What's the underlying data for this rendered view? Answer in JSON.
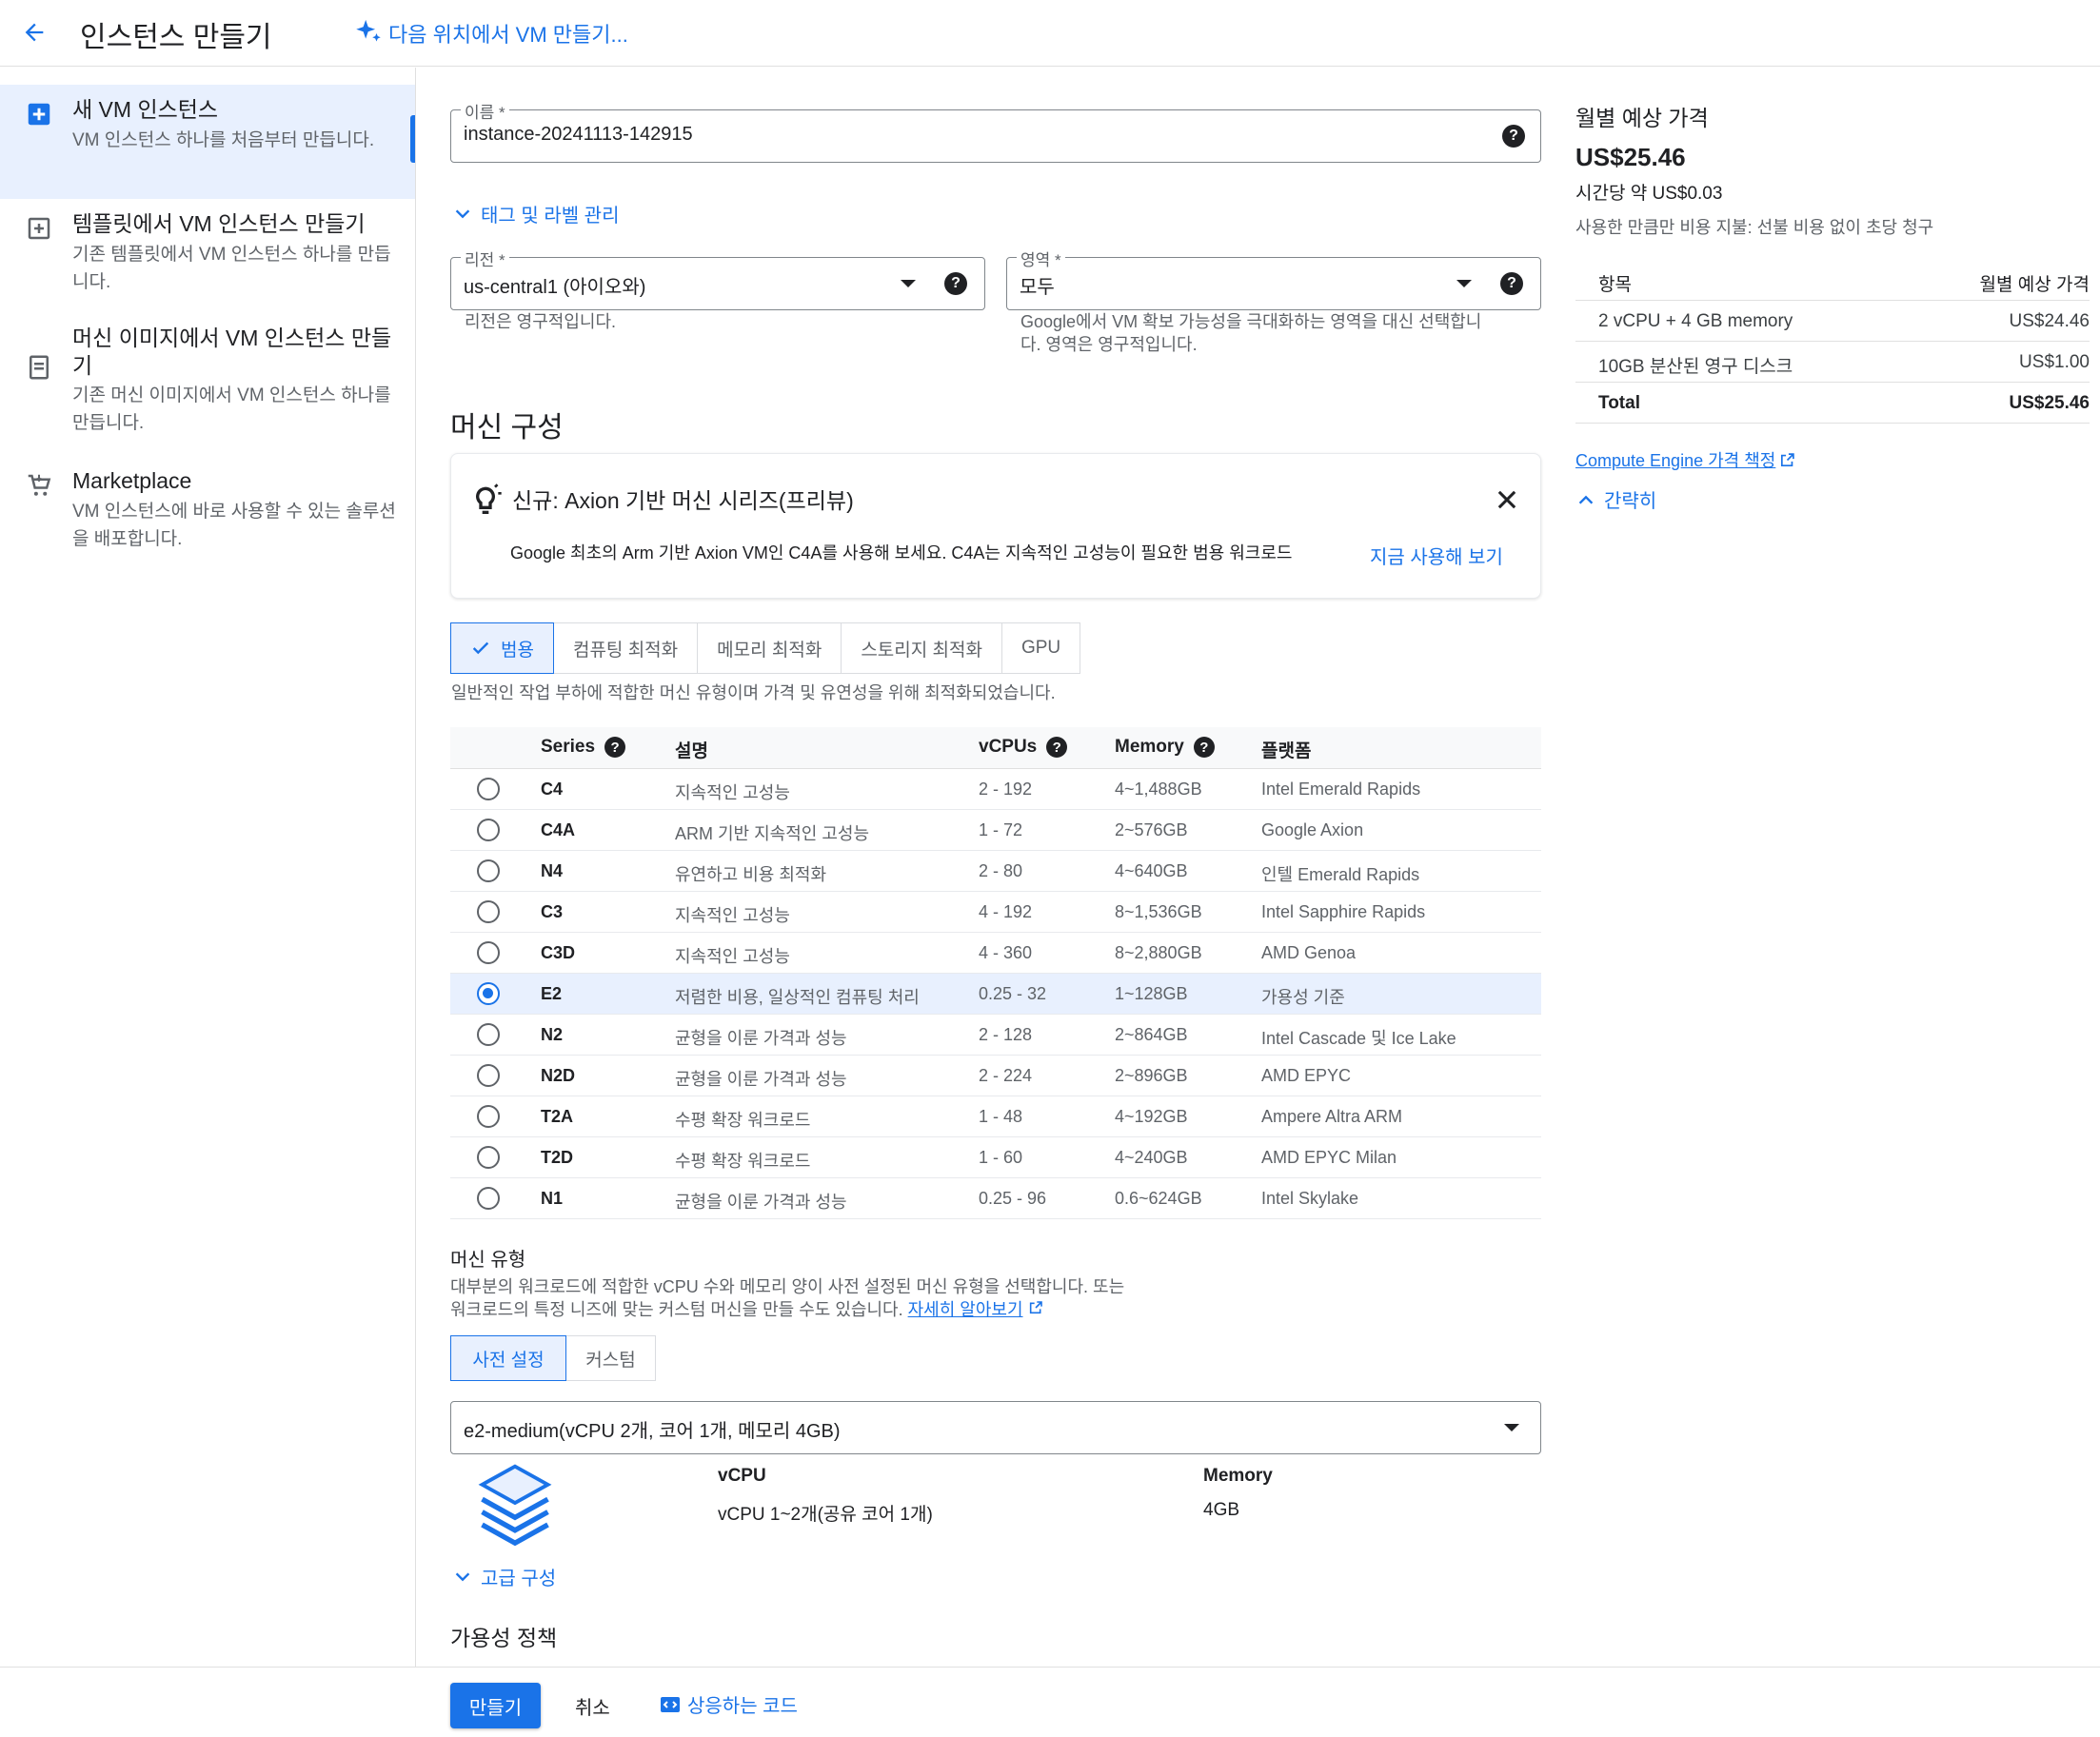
{
  "header": {
    "title": "인스턴스 만들기",
    "ai_link": "다음 위치에서 VM 만들기..."
  },
  "leftnav": {
    "items": [
      {
        "title": "새 VM 인스턴스",
        "desc": "VM 인스턴스 하나를 처음부터 만듭니다.",
        "icon": "add-box-icon"
      },
      {
        "title": "템플릿에서 VM 인스턴스 만들기",
        "desc": "기존 템플릿에서 VM 인스턴스 하나를 만듭니다.",
        "icon": "template-icon"
      },
      {
        "title": "머신 이미지에서 VM 인스턴스 만들기",
        "desc": "기존 머신 이미지에서 VM 인스턴스 하나를 만듭니다.",
        "icon": "machine-image-icon"
      },
      {
        "title": "Marketplace",
        "desc": "VM 인스턴스에 바로 사용할 수 있는 솔루션을 배포합니다.",
        "icon": "cart-icon"
      }
    ]
  },
  "form": {
    "name_label": "이름 *",
    "name_value": "instance-20241113-142915",
    "tags_link": "태그 및 라벨 관리",
    "region_label": "리전 *",
    "region_value": "us-central1 (아이오와)",
    "region_hint": "리전은 영구적입니다.",
    "zone_label": "영역 *",
    "zone_value": "모두",
    "zone_hint_1": "Google에서 VM 확보 가능성을 극대화하는 영역을 대신 선택합니",
    "zone_hint_2": "다. 영역은 영구적입니다."
  },
  "machine": {
    "section_title": "머신 구성",
    "banner_title": "신규: Axion 기반 머신 시리즈(프리뷰)",
    "banner_text": "Google 최초의 Arm 기반 Axion VM인 C4A를 사용해 보세요. C4A는 지속적인 고성능이 필요한 범용 워크로드",
    "banner_link": "지금 사용해 보기",
    "tabs": [
      "범용",
      "컴퓨팅 최적화",
      "메모리 최적화",
      "스토리지 최적화",
      "GPU"
    ],
    "tab_desc": "일반적인 작업 부하에 적합한 머신 유형이며 가격 및 유연성을 위해 최적화되었습니다.",
    "columns": {
      "series": "Series",
      "desc": "설명",
      "vcpus": "vCPUs",
      "memory": "Memory",
      "platform": "플랫폼"
    },
    "rows": [
      {
        "series": "C4",
        "desc": "지속적인 고성능",
        "vcpus": "2 - 192",
        "memory": "4~1,488GB",
        "platform": "Intel Emerald Rapids"
      },
      {
        "series": "C4A",
        "desc": "ARM 기반 지속적인 고성능",
        "vcpus": "1 - 72",
        "memory": "2~576GB",
        "platform": "Google Axion"
      },
      {
        "series": "N4",
        "desc": "유연하고 비용 최적화",
        "vcpus": "2 - 80",
        "memory": "4~640GB",
        "platform": "인텔 Emerald Rapids"
      },
      {
        "series": "C3",
        "desc": "지속적인 고성능",
        "vcpus": "4 - 192",
        "memory": "8~1,536GB",
        "platform": "Intel Sapphire Rapids"
      },
      {
        "series": "C3D",
        "desc": "지속적인 고성능",
        "vcpus": "4 - 360",
        "memory": "8~2,880GB",
        "platform": "AMD Genoa"
      },
      {
        "series": "E2",
        "desc": "저렴한 비용, 일상적인 컴퓨팅 처리",
        "vcpus": "0.25 - 32",
        "memory": "1~128GB",
        "platform": "가용성 기준"
      },
      {
        "series": "N2",
        "desc": "균형을 이룬 가격과 성능",
        "vcpus": "2 - 128",
        "memory": "2~864GB",
        "platform": "Intel Cascade 및 Ice Lake"
      },
      {
        "series": "N2D",
        "desc": "균형을 이룬 가격과 성능",
        "vcpus": "2 - 224",
        "memory": "2~896GB",
        "platform": "AMD EPYC"
      },
      {
        "series": "T2A",
        "desc": "수평 확장 워크로드",
        "vcpus": "1 - 48",
        "memory": "4~192GB",
        "platform": "Ampere Altra ARM"
      },
      {
        "series": "T2D",
        "desc": "수평 확장 워크로드",
        "vcpus": "1 - 60",
        "memory": "4~240GB",
        "platform": "AMD EPYC Milan"
      },
      {
        "series": "N1",
        "desc": "균형을 이룬 가격과 성능",
        "vcpus": "0.25 - 96",
        "memory": "0.6~624GB",
        "platform": "Intel Skylake"
      }
    ],
    "selected_series": "E2",
    "type_title": "머신 유형",
    "type_desc_1": "대부분의 워크로드에 적합한 vCPU 수와 메모리 양이 사전 설정된 머신 유형을 선택합니다. 또는",
    "type_desc_2": "워크로드의 특정 니즈에 맞는 커스텀 머신을 만들 수도 있습니다.",
    "learn_more": "자세히 알아보기",
    "type_tabs": [
      "사전 설정",
      "커스텀"
    ],
    "type_value": "e2-medium(vCPU 2개, 코어 1개, 메모리 4GB)",
    "vcpu_label": "vCPU",
    "vcpu_value": "vCPU 1~2개(공유 코어 1개)",
    "memory_label": "Memory",
    "memory_value": "4GB",
    "advanced_link": "고급 구성",
    "availability_title": "가용성 정책"
  },
  "pricing": {
    "title": "월별 예상 가격",
    "monthly": "US$25.46",
    "hourly": "시간당 약 US$0.03",
    "note": "사용한 만큼만 비용 지불: 선불 비용 없이 초당 청구",
    "col_item": "항목",
    "col_price": "월별 예상 가격",
    "rows": [
      {
        "item": "2 vCPU + 4 GB memory",
        "price": "US$24.46"
      },
      {
        "item": "10GB 분산된 영구 디스크",
        "price": "US$1.00"
      },
      {
        "item": "Total",
        "price": "US$25.46"
      }
    ],
    "pricing_link": "Compute Engine 가격 책정",
    "collapse_link": "간략히"
  },
  "footer": {
    "create": "만들기",
    "cancel": "취소",
    "code": "상응하는 코드"
  }
}
